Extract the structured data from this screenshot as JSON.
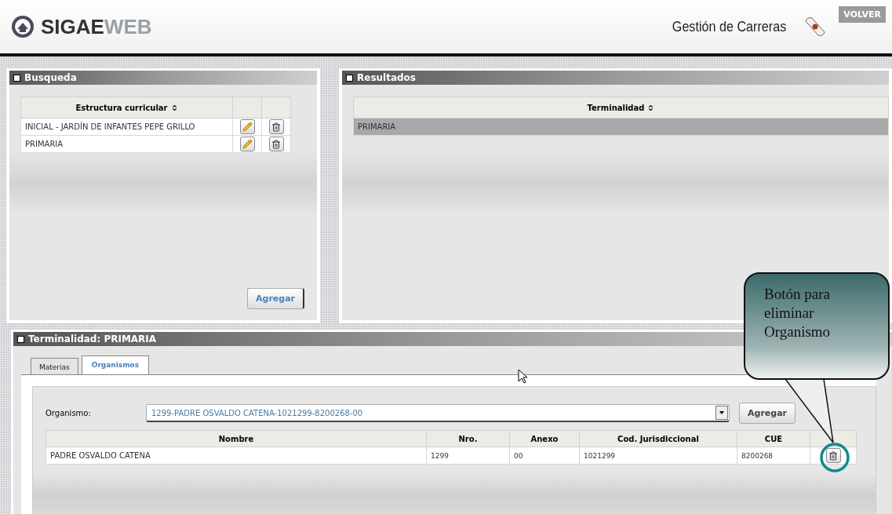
{
  "header": {
    "logo": {
      "part_1": "SIGAE",
      "part_2": "WEB"
    },
    "section_title": "Gestión de Carreras",
    "back_button": "VOLVER"
  },
  "busqueda": {
    "title": "Busqueda",
    "column": "Estructura curricular",
    "rows": [
      {
        "name": "INICIAL - JARDÍN DE INFANTES PEPE GRILLO",
        "selected": false
      },
      {
        "name": "PRIMARIA",
        "selected": false
      }
    ],
    "add_button": "Agregar"
  },
  "resultados": {
    "title": "Resultados",
    "column": "Terminalidad",
    "rows": [
      {
        "name": "PRIMARIA",
        "selected": true
      }
    ]
  },
  "detalle": {
    "title": "Terminalidad: PRIMARIA",
    "tabs": [
      {
        "label": "Materias",
        "selected": false
      },
      {
        "label": "Organismos",
        "selected": true
      }
    ],
    "organismo_label": "Organismo:",
    "organismo_value": "1299-PADRE OSVALDO CATENA-1021299-8200268-00",
    "add_button": "Agregar",
    "columns": [
      "Nombre",
      "Nro.",
      "Anexo",
      "Cod. Jurisdiccional",
      "CUE"
    ],
    "rows": [
      {
        "cells": [
          "PADRE OSVALDO CATENA",
          "1299",
          "00",
          "1021299",
          "8200268"
        ]
      }
    ]
  },
  "callout": {
    "text": "Botón para eliminar Organismo"
  }
}
